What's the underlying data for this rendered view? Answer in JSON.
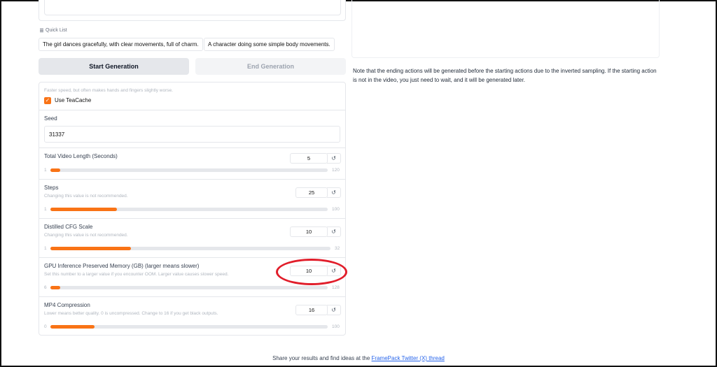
{
  "quick_list": {
    "label": "Quick List",
    "items": [
      "The girl dances gracefully, with clear movements, full of charm.",
      "A character doing some simple body movements."
    ]
  },
  "buttons": {
    "start": "Start Generation",
    "end": "End Generation"
  },
  "settings": {
    "teacache_info": "Faster speed, but often makes hands and fingers slightly worse.",
    "teacache_label": "Use TeaCache",
    "teacache_checked": true,
    "seed_label": "Seed",
    "seed_value": "31337",
    "sliders": [
      {
        "title": "Total Video Length (Seconds)",
        "info": "",
        "value": "5",
        "min": "1",
        "max": "120"
      },
      {
        "title": "Steps",
        "info": "Changing this value is not recommended.",
        "value": "25",
        "min": "1",
        "max": "100"
      },
      {
        "title": "Distilled CFG Scale",
        "info": "Changing this value is not recommended.",
        "value": "10",
        "min": "1",
        "max": "32"
      },
      {
        "title": "GPU Inference Preserved Memory (GB) (larger means slower)",
        "info": "Set this number to a larger value if you encounter OOM. Larger value causes slower speed.",
        "value": "10",
        "min": "6",
        "max": "128"
      },
      {
        "title": "MP4 Compression",
        "info": "Lower means better quality. 0 is uncompressed. Change to 16 if you get black outputs.",
        "value": "16",
        "min": "0",
        "max": "100"
      }
    ],
    "reset_glyph": "↺"
  },
  "note": "Note that the ending actions will be generated before the starting actions due to the inverted sampling. If the starting action is not in the video, you just need to wait, and it will be generated later.",
  "footer": {
    "text": "Share your results and find ideas at the ",
    "link": "FramePack Twitter (X) thread"
  },
  "colors": {
    "accent": "#f97316",
    "annotation": "#e11d2a",
    "link": "#2563eb"
  }
}
